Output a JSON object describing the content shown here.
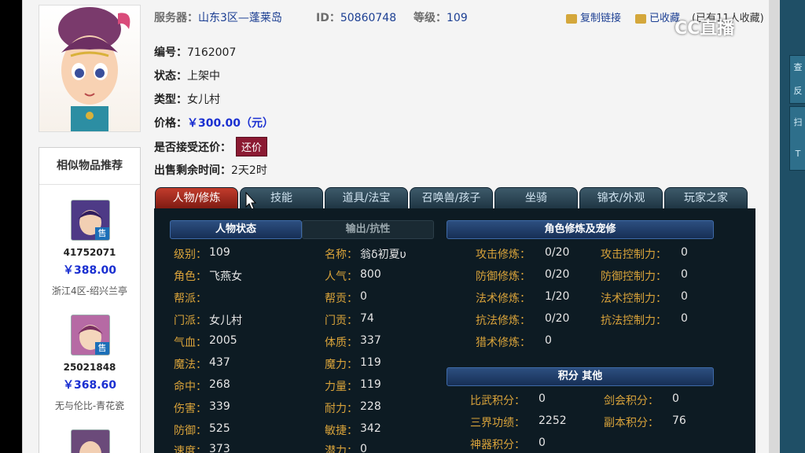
{
  "header": {
    "server_label": "服务器：",
    "server": "山东3区—蓬莱岛",
    "id_label": "ID：",
    "id": "50860748",
    "level_label": "等级：",
    "level": "109",
    "copy_link": "复制链接",
    "favorited": "已收藏",
    "fav_count": "(已有11人收藏)"
  },
  "watermark": "CC直播",
  "item": {
    "number_label": "编号：",
    "number": "7162007",
    "status_label": "状态：",
    "status": "上架中",
    "type_label": "类型：",
    "type": "女儿村",
    "price_label": "价格：",
    "price": "￥300.00（元）",
    "haggle_label": "是否接受还价：",
    "haggle_button": "还价",
    "time_label": "出售剩余时间：",
    "time": "2天2时"
  },
  "sidebar": {
    "title": "相似物品推荐",
    "badge": "售",
    "items": [
      {
        "id": "41752071",
        "price": "￥388.00",
        "server": "浙江4区-绍兴兰亭"
      },
      {
        "id": "25021848",
        "price": "￥368.60",
        "server": "无与伦比-青花瓷"
      }
    ]
  },
  "tabs": [
    "人物/修炼",
    "技能",
    "道具/法宝",
    "召唤兽/孩子",
    "坐骑",
    "锦衣/外观",
    "玩家之家"
  ],
  "panel": {
    "head_char": "人物状态",
    "head_output": "输出/抗性",
    "head_cultivation": "角色修炼及宠修",
    "head_points": "积分 其他",
    "left_stats": [
      {
        "label": "级别：",
        "value": "109"
      },
      {
        "label": "角色：",
        "value": "飞燕女"
      },
      {
        "label": "帮派：",
        "value": ""
      },
      {
        "label": "门派：",
        "value": "女儿村"
      },
      {
        "label": "气血：",
        "value": "2005"
      },
      {
        "label": "魔法：",
        "value": "437"
      },
      {
        "label": "命中：",
        "value": "268"
      },
      {
        "label": "伤害：",
        "value": "339"
      },
      {
        "label": "防御：",
        "value": "525"
      },
      {
        "label": "速度：",
        "value": "373"
      }
    ],
    "mid_stats": [
      {
        "label": "名称：",
        "value": "翁δ初夏υ"
      },
      {
        "label": "人气：",
        "value": "800"
      },
      {
        "label": "帮贡：",
        "value": "0"
      },
      {
        "label": "门贡：",
        "value": "74"
      },
      {
        "label": "体质：",
        "value": "337"
      },
      {
        "label": "魔力：",
        "value": "119"
      },
      {
        "label": "力量：",
        "value": "119"
      },
      {
        "label": "耐力：",
        "value": "228"
      },
      {
        "label": "敏捷：",
        "value": "342"
      },
      {
        "label": "潜力：",
        "value": "0"
      }
    ],
    "cultivation": [
      {
        "label": "攻击修炼：",
        "value": "0/20"
      },
      {
        "label": "防御修炼：",
        "value": "0/20"
      },
      {
        "label": "法术修炼：",
        "value": "1/20"
      },
      {
        "label": "抗法修炼：",
        "value": "0/20"
      },
      {
        "label": "猎术修炼：",
        "value": "0"
      }
    ],
    "control": [
      {
        "label": "攻击控制力：",
        "value": "0"
      },
      {
        "label": "防御控制力：",
        "value": "0"
      },
      {
        "label": "法术控制力：",
        "value": "0"
      },
      {
        "label": "抗法控制力：",
        "value": "0"
      }
    ],
    "points_left": [
      {
        "label": "比武积分：",
        "value": "0"
      },
      {
        "label": "三界功绩：",
        "value": "2252"
      },
      {
        "label": "神器积分：",
        "value": "0"
      }
    ],
    "points_right": [
      {
        "label": "剑会积分：",
        "value": "0"
      },
      {
        "label": "副本积分：",
        "value": "76"
      }
    ]
  },
  "right_tabs": [
    "查",
    "反",
    "扫",
    "T"
  ]
}
